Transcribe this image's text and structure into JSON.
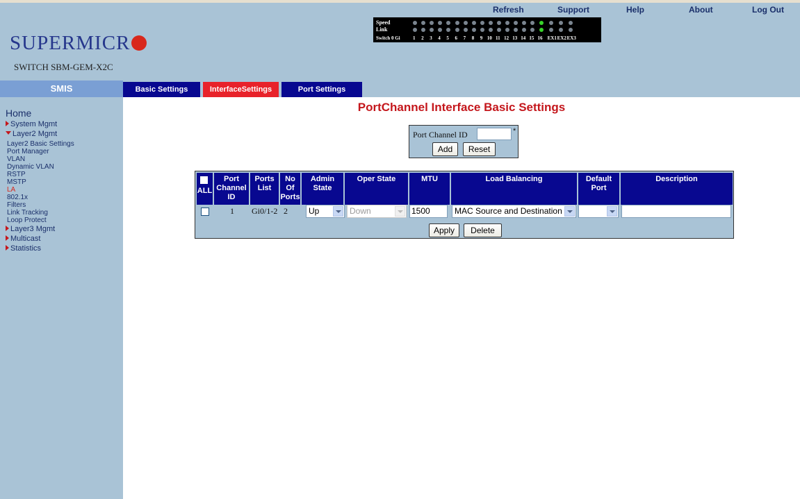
{
  "header": {
    "logo_text": "SUPERMICR",
    "model": "SWITCH SBM-GEM-X2C",
    "links": [
      "Refresh",
      "Support",
      "Help",
      "About",
      "Log Out"
    ],
    "led_panel": {
      "row_labels": [
        "Speed",
        "Link",
        "Switch 0 Gi"
      ],
      "port_labels": [
        "1",
        "2",
        "3",
        "4",
        "5",
        "6",
        "7",
        "8",
        "9",
        "10",
        "11",
        "12",
        "13",
        "14",
        "15",
        "16",
        "EX1",
        "EX2",
        "EX3"
      ],
      "speed_on_ports": [
        "16"
      ],
      "link_on_ports": [
        "16"
      ]
    }
  },
  "nav": {
    "brand": "SMIS",
    "tabs": [
      {
        "label": "Basic Settings",
        "active": false
      },
      {
        "label": "InterfaceSettings",
        "active": true
      },
      {
        "label": "Port Settings",
        "active": false
      }
    ]
  },
  "sidebar": {
    "home": "Home",
    "items": [
      {
        "label": "System Mgmt",
        "expanded": false
      },
      {
        "label": "Layer2 Mgmt",
        "expanded": true
      },
      {
        "label": "Layer3 Mgmt",
        "expanded": false
      },
      {
        "label": "Multicast",
        "expanded": false
      },
      {
        "label": "Statistics",
        "expanded": false
      }
    ],
    "layer2_subitems": [
      {
        "label": "Layer2 Basic Settings",
        "active": false
      },
      {
        "label": "Port Manager",
        "active": false
      },
      {
        "label": "VLAN",
        "active": false
      },
      {
        "label": "Dynamic VLAN",
        "active": false
      },
      {
        "label": "RSTP",
        "active": false
      },
      {
        "label": "MSTP",
        "active": false
      },
      {
        "label": "LA",
        "active": true
      },
      {
        "label": "802.1x",
        "active": false
      },
      {
        "label": "Filters",
        "active": false
      },
      {
        "label": "Link Tracking",
        "active": false
      },
      {
        "label": "Loop Protect",
        "active": false
      }
    ]
  },
  "main": {
    "title": "PortChannel Interface Basic Settings",
    "form": {
      "port_channel_label": "Port Channel ID",
      "port_channel_value": "",
      "required_mark": "*",
      "add_label": "Add",
      "reset_label": "Reset"
    },
    "table": {
      "all_label": "ALL",
      "headers": [
        "Port Channel ID",
        "Ports List",
        "No Of Ports",
        "Admin State",
        "Oper State",
        "MTU",
        "Load Balancing",
        "Default Port",
        "Description"
      ],
      "rows": [
        {
          "selected": false,
          "port_channel_id": "1",
          "ports_list": "Gi0/1-2",
          "no_of_ports": "2",
          "admin_state": "Up",
          "oper_state": "Down",
          "mtu": "1500",
          "load_balancing": "MAC Source and Destination",
          "default_port": "",
          "description": ""
        }
      ],
      "apply_label": "Apply",
      "delete_label": "Delete"
    }
  },
  "colors": {
    "background_panel": "#a9c3d6",
    "nav_blue": "#080890",
    "active_red": "#e8222a",
    "title_red": "#c4171c",
    "smis_blue": "#7a9fd4"
  }
}
